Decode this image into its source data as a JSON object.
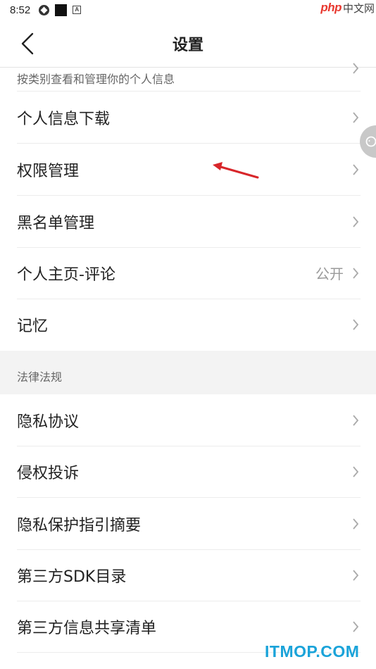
{
  "status_bar": {
    "time": "8:52",
    "a_icon_letter": "A"
  },
  "watermark_top": {
    "php": "php",
    "cn": "中文网"
  },
  "header": {
    "title": "设置"
  },
  "partial_item": {
    "subtitle": "按类别查看和管理你的个人信息"
  },
  "items": [
    {
      "label": "个人信息下载",
      "value": ""
    },
    {
      "label": "权限管理",
      "value": ""
    },
    {
      "label": "黑名单管理",
      "value": ""
    },
    {
      "label": "个人主页-评论",
      "value": "公开"
    },
    {
      "label": "记忆",
      "value": ""
    }
  ],
  "section": {
    "title": "法律法规"
  },
  "legal_items": [
    {
      "label": "隐私协议"
    },
    {
      "label": "侵权投诉"
    },
    {
      "label": "隐私保护指引摘要"
    },
    {
      "label": "第三方SDK目录"
    },
    {
      "label": "第三方信息共享清单"
    }
  ],
  "watermark_bottom": {
    "text": "ITMOP.COM"
  },
  "colors": {
    "annotation_arrow": "#d8262a",
    "chevron": "#aaaaaa",
    "section_bg": "#f3f3f3",
    "watermark_blue": "#1aa3d9"
  },
  "icons": [
    "app-icon",
    "square-icon",
    "a-icon",
    "back-chevron-icon",
    "chevron-right-icon",
    "floating-assistant-icon",
    "red-arrow-annotation"
  ]
}
